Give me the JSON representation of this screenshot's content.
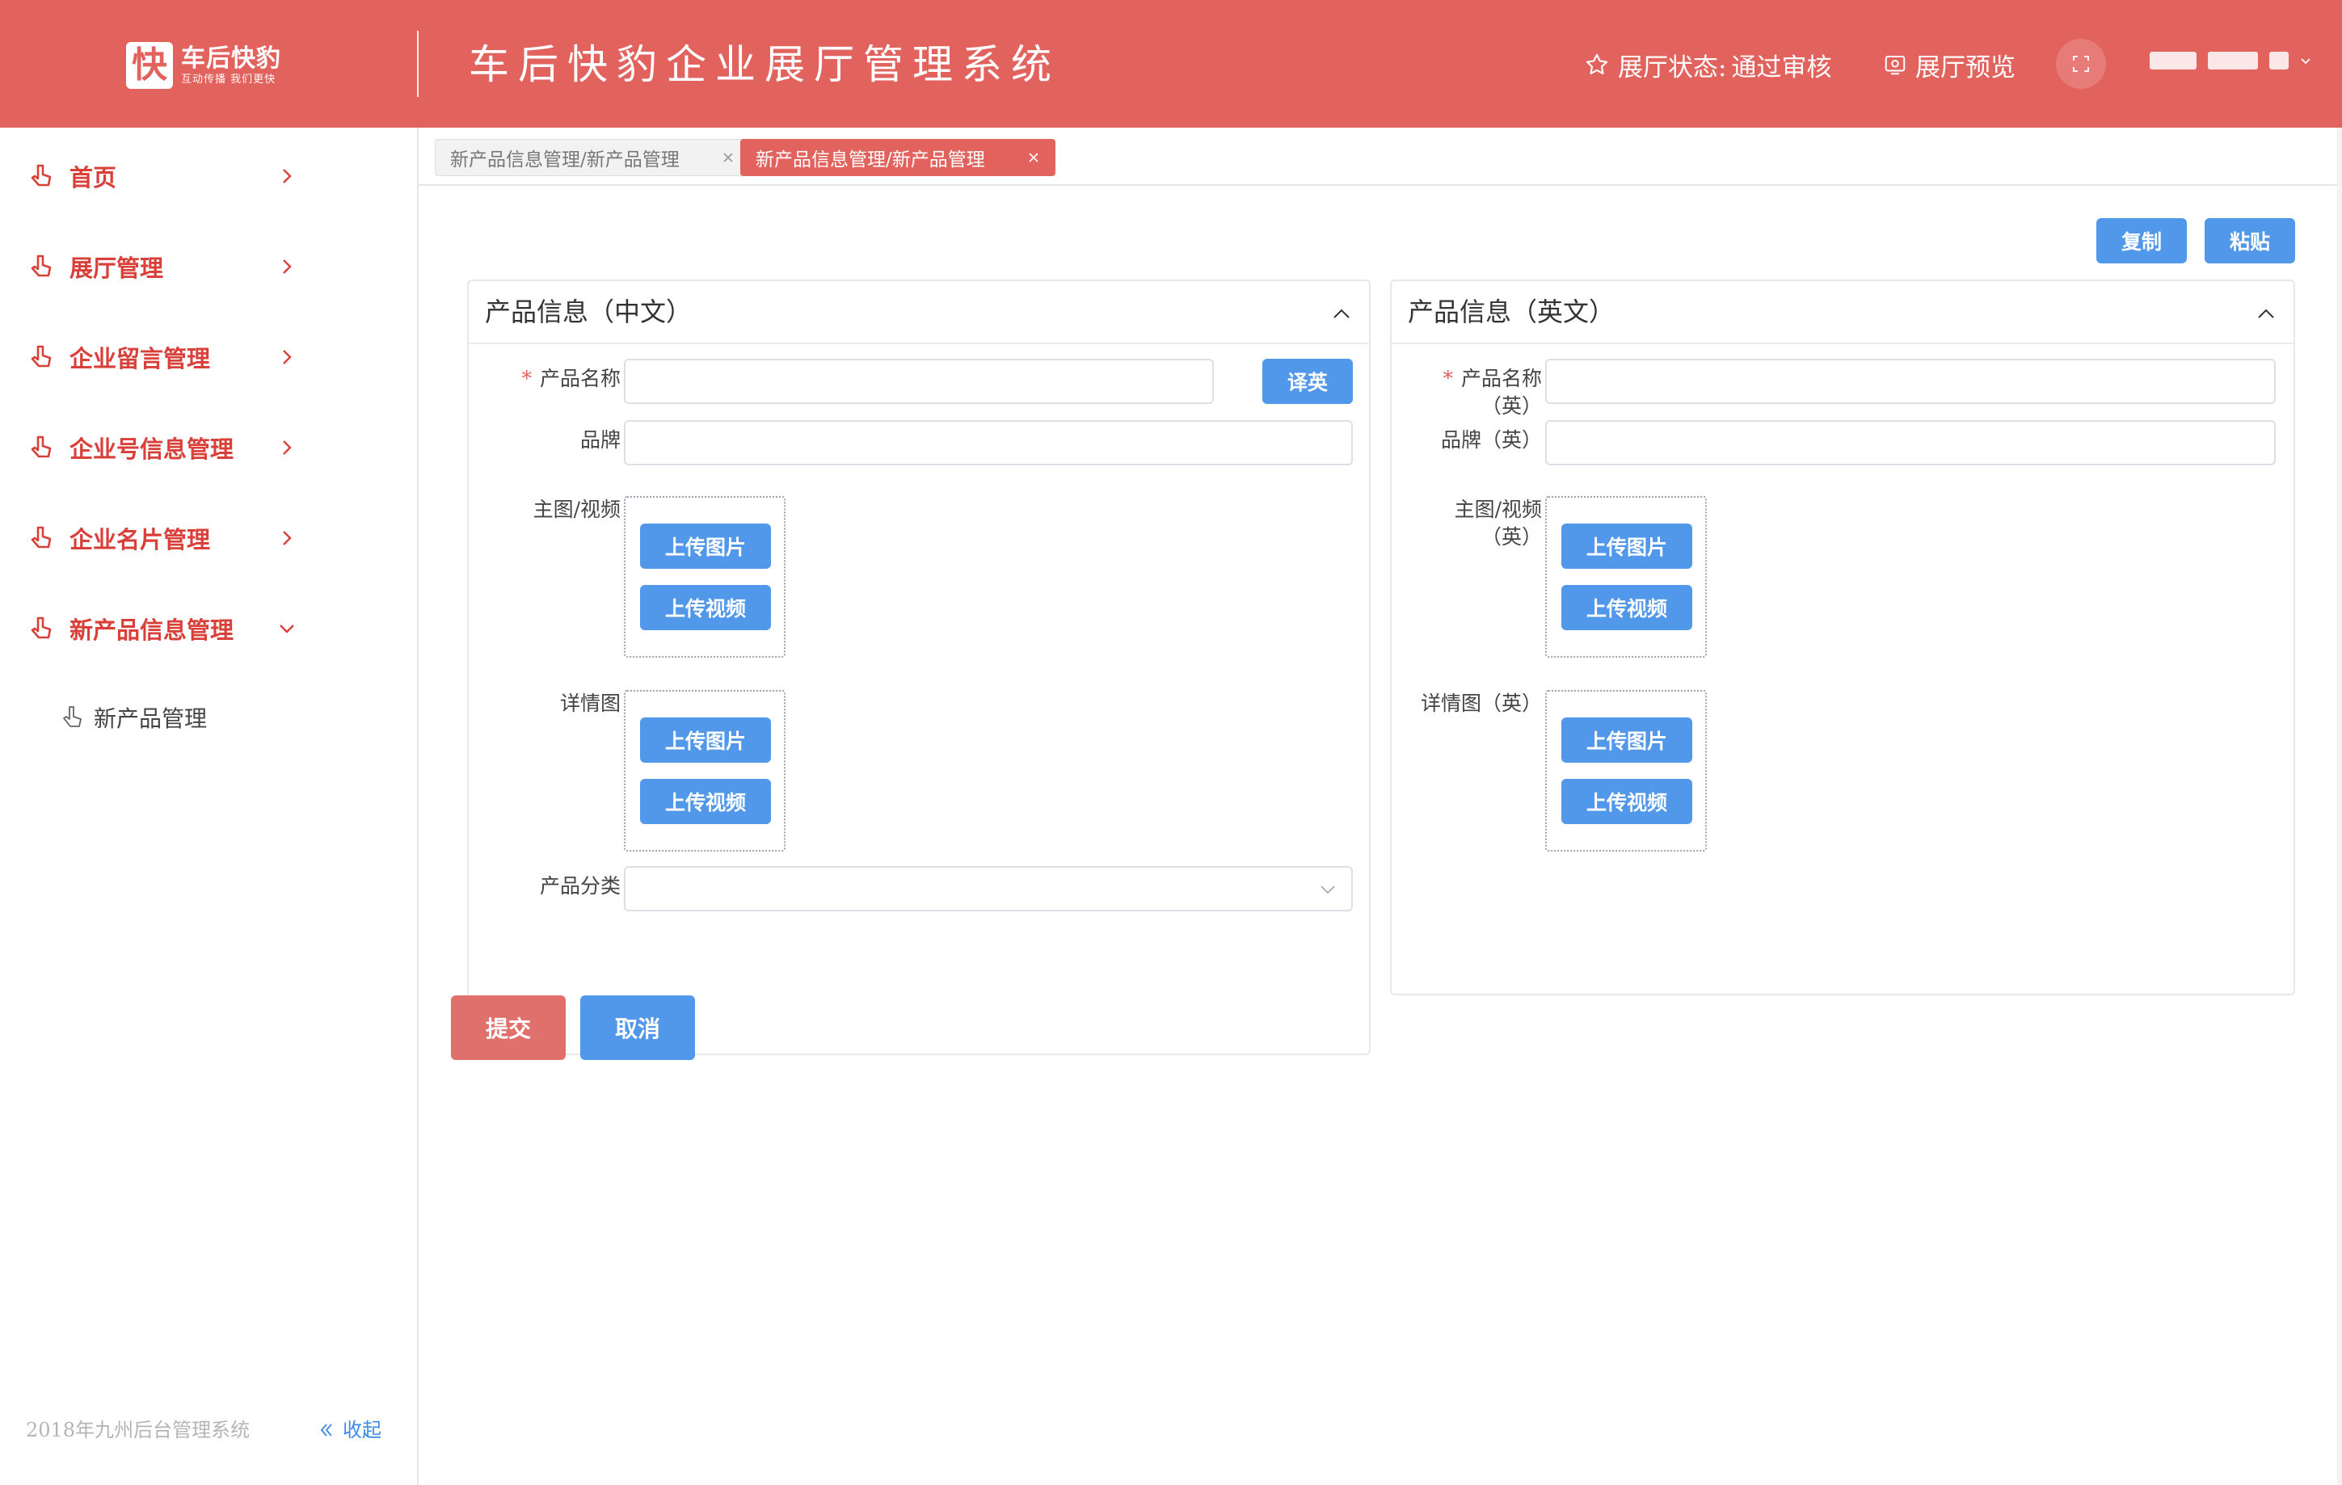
{
  "header": {
    "logo_mark": "快",
    "logo_name": "车后快豹",
    "logo_slogan": "互动传播 我们更快",
    "title": "车后快豹企业展厅管理系统",
    "status_label": "展厅状态:",
    "status_value": "通过审核",
    "preview_label": "展厅预览",
    "colors": {
      "primary": "#e2625e",
      "text": "#ffffff"
    }
  },
  "sidebar": {
    "items": [
      {
        "label": "首页",
        "expanded": false
      },
      {
        "label": "展厅管理",
        "expanded": false
      },
      {
        "label": "企业留言管理",
        "expanded": false
      },
      {
        "label": "企业号信息管理",
        "expanded": false
      },
      {
        "label": "企业名片管理",
        "expanded": false
      },
      {
        "label": "新产品信息管理",
        "expanded": true
      }
    ],
    "sub_items": [
      {
        "label": "新产品管理"
      }
    ],
    "footer": "2018年九州后台管理系统",
    "collapse_label": "收起",
    "colors": {
      "menu_text": "#d9403a",
      "link": "#3d8be8"
    }
  },
  "tabs": [
    {
      "label": "新产品信息管理/新产品管理",
      "active": false
    },
    {
      "label": "新产品信息管理/新产品管理",
      "active": true
    }
  ],
  "toolbar": {
    "copy_label": "复制",
    "paste_label": "粘贴"
  },
  "form_cn": {
    "title": "产品信息（中文）",
    "name_label": "产品名称",
    "name_value": "",
    "translate_label": "译英",
    "brand_label": "品牌",
    "brand_value": "",
    "main_media_label": "主图/视频",
    "detail_label": "详情图",
    "upload_image": "上传图片",
    "upload_video": "上传视频",
    "category_label": "产品分类",
    "category_value": ""
  },
  "form_en": {
    "title": "产品信息（英文）",
    "name_label": "产品名称（英）",
    "name_value": "",
    "brand_label": "品牌（英）",
    "brand_value": "",
    "main_media_label": "主图/视频（英）",
    "detail_label": "详情图（英）",
    "upload_image": "上传图片",
    "upload_video": "上传视频"
  },
  "actions": {
    "submit_label": "提交",
    "cancel_label": "取消"
  },
  "colors": {
    "button_blue": "#5298ea",
    "submit_red": "#e0706b"
  }
}
